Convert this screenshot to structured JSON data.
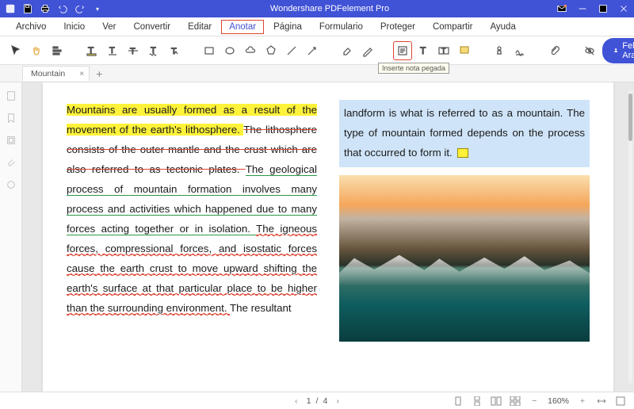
{
  "app": {
    "title": "Wondershare PDFelement Pro"
  },
  "user": {
    "name": "Felipe Araujo"
  },
  "menu": {
    "items": [
      "Archivo",
      "Inicio",
      "Ver",
      "Convertir",
      "Editar",
      "Anotar",
      "Página",
      "Formulario",
      "Proteger",
      "Compartir",
      "Ayuda"
    ],
    "active_index": 5
  },
  "toolbar": {
    "tooltip": "Inserte nota pegada"
  },
  "tabs": {
    "current": "Mountain"
  },
  "document": {
    "left_para": {
      "s1": "Mountains are usually formed as a result of the movement of the earth's lithosphere. ",
      "s2": "The lithosphere consists of the outer mantle and the crust which are also referred to as tectonic plates. ",
      "s3": "The geological process of mountain formation involves many process and activities which happened due to many forces acting together or in isolation. ",
      "s4": "The igneous forces, compressional forces, and isostatic forces cause the earth crust to move upward shifting the earth's surface at that particular place to be higher than the surrounding environment. ",
      "s5": "The resultant"
    },
    "right_box": "landform is what is referred to as a mountain. The type of mountain formed depends on the process that occurred to form it."
  },
  "status": {
    "page_current": "1",
    "page_sep": "/",
    "page_total": "4",
    "zoom": "160%"
  }
}
